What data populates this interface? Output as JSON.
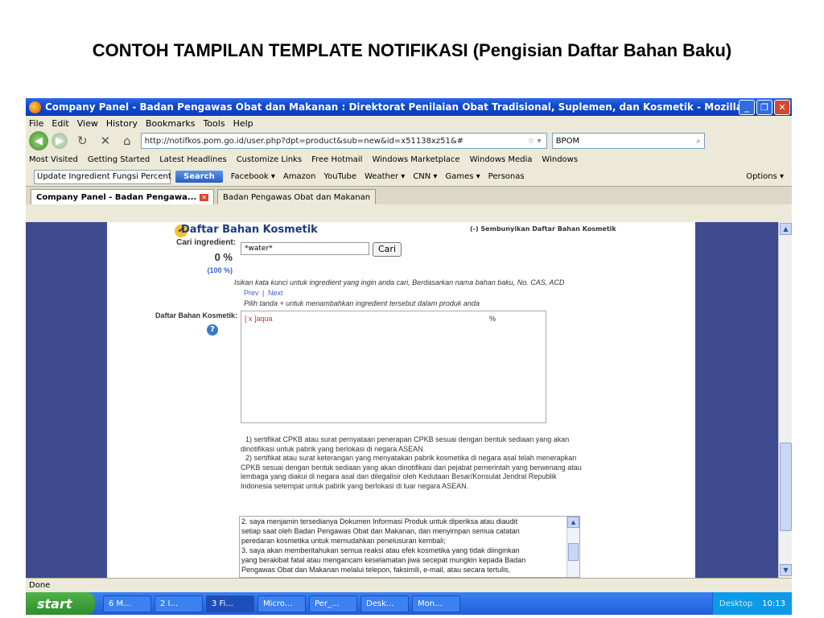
{
  "slide": {
    "title": "CONTOH TAMPILAN TEMPLATE NOTIFIKASI (Pengisian Daftar Bahan Baku)"
  },
  "window": {
    "title": "Company Panel - Badan Pengawas Obat dan Makanan : Direktorat Penilaian Obat Tradisional, Suplemen, dan Kosmetik - Mozilla Firefox"
  },
  "menu": [
    "File",
    "Edit",
    "View",
    "History",
    "Bookmarks",
    "Tools",
    "Help"
  ],
  "nav": {
    "url": "http://notifkos.pom.go.id/user.php?dpt=product&sub=new&id=x51138xz51&#",
    "search_value": "BPOM"
  },
  "bookmarks": [
    "Most Visited",
    "Getting Started",
    "Latest Headlines",
    "Customize Links",
    "Free Hotmail",
    "Windows Marketplace",
    "Windows Media",
    "Windows"
  ],
  "toolbar2": {
    "ask_value": "Update Ingredient Fungsi Percent",
    "search_label": "Search",
    "items": [
      "Facebook ▾",
      "Amazon",
      "YouTube",
      "Weather ▾",
      "CNN ▾",
      "Games ▾",
      "Personas"
    ],
    "options": "Options ▾"
  },
  "tabs": [
    {
      "label": "Company Panel - Badan Pengawa..."
    },
    {
      "label": "Badan Pengawas Obat dan Makanan"
    }
  ],
  "page": {
    "section_title": "Daftar Bahan Kosmetik",
    "hide_link": "(-) Sembunyikan Daftar Bahan Kosmetik",
    "search_label": "Cari ingredient:",
    "search_value": "*water*",
    "cari_button": "Cari",
    "percent_value": "0 %",
    "percent_total": "(100 %)",
    "hint": "Isikan kata kunci untuk ingredient yang ingin anda cari, Berdasarkan nama bahan baku, No. CAS, ACD",
    "prev": "Prev",
    "separator": "|",
    "next": "Next",
    "pick_hint": "Pilih tanda + untuk menambahkan ingredient tersebut dalam produk anda",
    "list_label": "Daftar Bahan Kosmetik:",
    "list_item": "[ x ]aqua",
    "list_percent": "%",
    "notes": [
      "1) sertifikat CPKB atau surat pernyataan penerapan CPKB sesuai dengan bentuk sediaan yang akan",
      "dinotifikasi untuk pabrik yang berlokasi di negara ASEAN.",
      "2) sertifikat atau surat keterangan yang menyatakan pabrik kosmetika di negara asal telah menerapkan",
      "CPKB sesuai dengan bentuk sediaan yang akan dinotifikasi dari pejabat pemerintah yang berwenang atau",
      "lembaga yang diakui di negara asal dan dilegalisir oleh Kedutaan Besar/Konsulat Jendral Republik",
      "Indonesia setempat untuk pabrik yang berlokasi di luar negara ASEAN."
    ],
    "scroll_text": [
      "2. saya menjamin tersedianya Dokumen Informasi Produk untuk diperiksa atau diaudit",
      "setiap saat oleh Badan Pengawas Obat dan Makanan, dan menyimpan semua catatan",
      "peredaran kosmetika untuk memudahkan penelusuran kembali;",
      "3. saya akan memberitahukan semua reaksi atau efek kosmetika yang tidak diinginkan",
      "yang berakibat fatal atau mengancam keselamatan jiwa secepat mungkin kepada Badan",
      "Pengawas Obat dan Makanan melalui telepon, faksimili, e-mail, atau secara tertulis,"
    ]
  },
  "status": "Done",
  "taskbar": {
    "start": "start",
    "tasks": [
      "6 M...",
      "2 I...",
      "3 Fi...",
      "Micro...",
      "Per_...",
      "Desk...",
      "Mon..."
    ],
    "desktop": "Desktop",
    "clock": "10:13"
  }
}
